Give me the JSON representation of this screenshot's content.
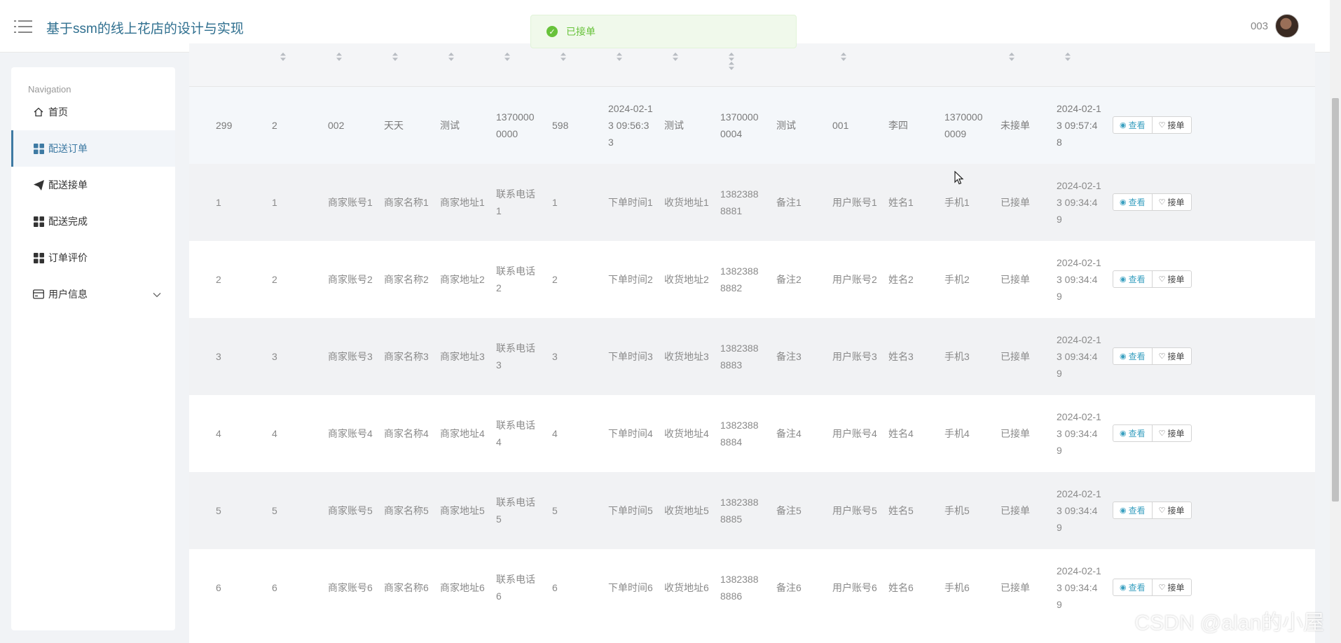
{
  "header": {
    "title": "基于ssm的线上花店的设计与实现",
    "username": "003"
  },
  "toast": {
    "message": "已接单",
    "type": "success"
  },
  "sidebar": {
    "heading": "Navigation",
    "items": [
      {
        "label": "首页",
        "icon": "home-icon"
      },
      {
        "label": "配送订单",
        "icon": "grid-icon",
        "active": true
      },
      {
        "label": "配送接单",
        "icon": "paper-plane-icon"
      },
      {
        "label": "配送完成",
        "icon": "grid-icon"
      },
      {
        "label": "订单评价",
        "icon": "grid-icon"
      },
      {
        "label": "用户信息",
        "icon": "card-icon",
        "expandable": true
      }
    ]
  },
  "table": {
    "actions": {
      "view": "查看",
      "accept": "接单"
    },
    "rows": [
      {
        "id": "299",
        "c2": "2",
        "merchant_account": "002",
        "merchant_name": "天天",
        "merchant_addr": "测试",
        "merchant_phone": "13700000000",
        "amount": "598",
        "order_time": "2024-02-13 09:56:33",
        "delivery_addr": "测试",
        "recv_phone": "13700000004",
        "note": "测试",
        "user_account": "001",
        "user_name": "李四",
        "user_phone": "13700000009",
        "status": "未接单",
        "created": "2024-02-13 09:57:48"
      },
      {
        "id": "1",
        "c2": "1",
        "merchant_account": "商家账号1",
        "merchant_name": "商家名称1",
        "merchant_addr": "商家地址1",
        "merchant_phone": "联系电话1",
        "amount": "1",
        "order_time": "下单时间1",
        "delivery_addr": "收货地址1",
        "recv_phone": "13823888881",
        "note": "备注1",
        "user_account": "用户账号1",
        "user_name": "姓名1",
        "user_phone": "手机1",
        "status": "已接单",
        "created": "2024-02-13 09:34:49"
      },
      {
        "id": "2",
        "c2": "2",
        "merchant_account": "商家账号2",
        "merchant_name": "商家名称2",
        "merchant_addr": "商家地址2",
        "merchant_phone": "联系电话2",
        "amount": "2",
        "order_time": "下单时间2",
        "delivery_addr": "收货地址2",
        "recv_phone": "13823888882",
        "note": "备注2",
        "user_account": "用户账号2",
        "user_name": "姓名2",
        "user_phone": "手机2",
        "status": "已接单",
        "created": "2024-02-13 09:34:49"
      },
      {
        "id": "3",
        "c2": "3",
        "merchant_account": "商家账号3",
        "merchant_name": "商家名称3",
        "merchant_addr": "商家地址3",
        "merchant_phone": "联系电话3",
        "amount": "3",
        "order_time": "下单时间3",
        "delivery_addr": "收货地址3",
        "recv_phone": "13823888883",
        "note": "备注3",
        "user_account": "用户账号3",
        "user_name": "姓名3",
        "user_phone": "手机3",
        "status": "已接单",
        "created": "2024-02-13 09:34:49"
      },
      {
        "id": "4",
        "c2": "4",
        "merchant_account": "商家账号4",
        "merchant_name": "商家名称4",
        "merchant_addr": "商家地址4",
        "merchant_phone": "联系电话4",
        "amount": "4",
        "order_time": "下单时间4",
        "delivery_addr": "收货地址4",
        "recv_phone": "13823888884",
        "note": "备注4",
        "user_account": "用户账号4",
        "user_name": "姓名4",
        "user_phone": "手机4",
        "status": "已接单",
        "created": "2024-02-13 09:34:49"
      },
      {
        "id": "5",
        "c2": "5",
        "merchant_account": "商家账号5",
        "merchant_name": "商家名称5",
        "merchant_addr": "商家地址5",
        "merchant_phone": "联系电话5",
        "amount": "5",
        "order_time": "下单时间5",
        "delivery_addr": "收货地址5",
        "recv_phone": "13823888885",
        "note": "备注5",
        "user_account": "用户账号5",
        "user_name": "姓名5",
        "user_phone": "手机5",
        "status": "已接单",
        "created": "2024-02-13 09:34:49"
      },
      {
        "id": "6",
        "c2": "6",
        "merchant_account": "商家账号6",
        "merchant_name": "商家名称6",
        "merchant_addr": "商家地址6",
        "merchant_phone": "联系电话6",
        "amount": "6",
        "order_time": "下单时间6",
        "delivery_addr": "收货地址6",
        "recv_phone": "13823888886",
        "note": "备注6",
        "user_account": "用户账号6",
        "user_name": "姓名6",
        "user_phone": "手机6",
        "status": "已接单",
        "created": "2024-02-13 09:34:49"
      }
    ]
  },
  "watermark": "CSDN @alan的小屋",
  "colors": {
    "accent": "#3e7aa3",
    "toast_bg": "#f0f9eb",
    "toast_text": "#67c23a"
  }
}
